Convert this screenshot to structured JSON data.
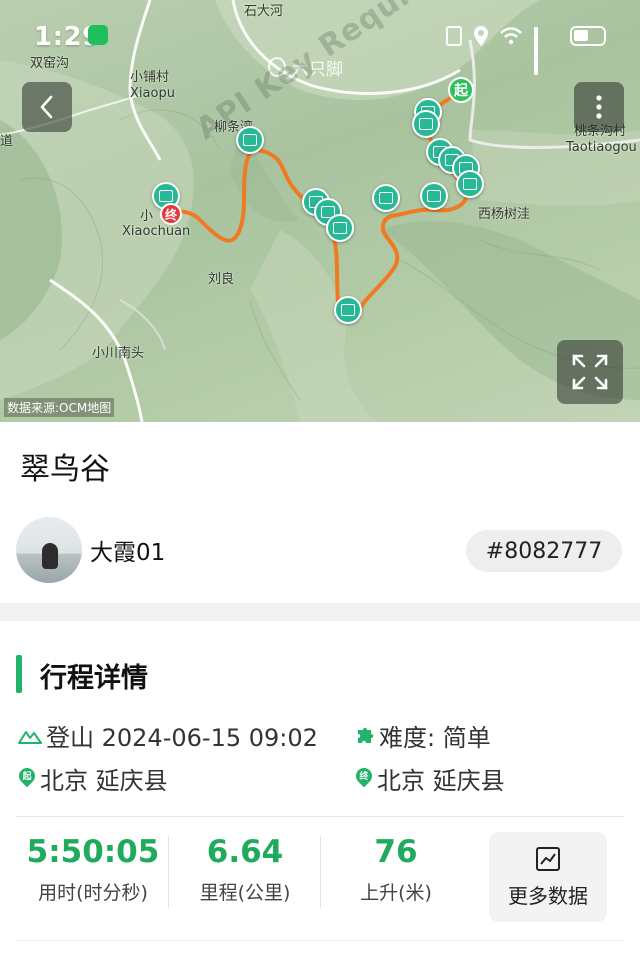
{
  "status_bar": {
    "time": "1:29"
  },
  "map": {
    "watermark": "六只脚",
    "api_notice": "API Key Required",
    "source": "数据来源:OCM地图",
    "start_marker": "起",
    "end_marker": "终",
    "labels": {
      "shuangyaogou": "双窑沟",
      "xiaopu_cn": "小铺村",
      "xiaopu_en": "Xiaopu",
      "liutiaowan": "柳条湾",
      "xiaochuan_cn": "小",
      "xiaochuan_en": "Xiaochuan",
      "liuliang": "刘良",
      "xiaochuannantou": "小川南头",
      "taotiaogou_cn": "桃条沟村",
      "taotiaogou_en": "Taotiaogou",
      "xiyangshuwa": "西杨树洼",
      "dao": "道",
      "shiliuhe": "石大河"
    }
  },
  "trail": {
    "title": "翠鸟谷",
    "author": "大霞01",
    "track_id": "#8082777"
  },
  "details": {
    "section_title": "行程详情",
    "type_date": "登山 2024-06-15 09:02",
    "difficulty": "难度:  简单",
    "start_place": "北京 延庆县",
    "end_place": "北京 延庆县",
    "start_badge": "起",
    "end_badge": "终"
  },
  "stats": {
    "duration": {
      "value": "5:50:05",
      "label": "用时(时分秒)"
    },
    "distance": {
      "value": "6.64",
      "label": "里程(公里)"
    },
    "ascent": {
      "value": "76",
      "label": "上升(米)"
    },
    "more_label": "更多数据"
  },
  "colors": {
    "accent": "#22b36a",
    "route": "#f07a22",
    "photo_pin": "#27b896"
  }
}
